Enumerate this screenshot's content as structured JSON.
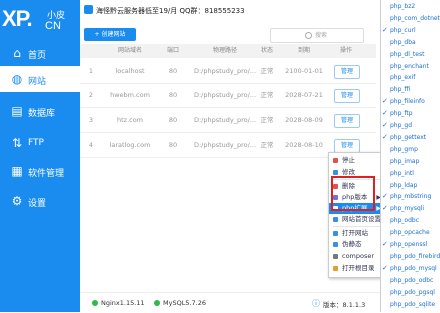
{
  "logo": {
    "big": "XP.",
    "small1": "小皮",
    "small2": "CN"
  },
  "nav": [
    {
      "label": "首页",
      "icon": "home-icon"
    },
    {
      "label": "网站",
      "icon": "globe-icon",
      "active": true
    },
    {
      "label": "数据库",
      "icon": "database-icon"
    },
    {
      "label": "FTP",
      "icon": "ftp-icon"
    },
    {
      "label": "软件管理",
      "icon": "apps-icon"
    },
    {
      "label": "设置",
      "icon": "gear-icon"
    }
  ],
  "titlebar": {
    "text": "海怪黔云服务器低至19/月 QQ群：818555233"
  },
  "toolbar": {
    "create_label": "+ 创建网站",
    "search_placeholder": "搜索"
  },
  "table": {
    "headers": [
      "网站域名",
      "端口",
      "物理路径",
      "状态",
      "到期",
      "操作"
    ],
    "rows": [
      {
        "num": "1",
        "domain": "localhost",
        "port": "80",
        "path": "D:/phpstudy_pro/...",
        "status": "正常",
        "expire": "2100-01-01",
        "action": "管理"
      },
      {
        "num": "2",
        "domain": "hwebm.com",
        "port": "80",
        "path": "D:/phpstudy_pro/...",
        "status": "正常",
        "expire": "2028-07-21",
        "action": "管理"
      },
      {
        "num": "3",
        "domain": "htz.com",
        "port": "80",
        "path": "D:/phpstudy_pro/...",
        "status": "正常",
        "expire": "2028-08-09",
        "action": "管理"
      },
      {
        "num": "4",
        "domain": "laratlog.com",
        "port": "80",
        "path": "D:/phpstudy_pro/...",
        "status": "正常",
        "expire": "2028-08-10",
        "action": "管理"
      }
    ]
  },
  "context_menu": {
    "items": [
      "停止",
      "修改",
      "删除",
      "php版本",
      "php扩展",
      "网站首页设置",
      "打开网站",
      "伪静态",
      "composer",
      "打开根目录"
    ],
    "highlighted": "php扩展"
  },
  "php_extensions": [
    {
      "name": "php_bz2",
      "checked": false
    },
    {
      "name": "php_com_dotnet",
      "checked": false
    },
    {
      "name": "php_curl",
      "checked": true
    },
    {
      "name": "php_dba",
      "checked": false
    },
    {
      "name": "php_dl_test",
      "checked": false
    },
    {
      "name": "php_enchant",
      "checked": false
    },
    {
      "name": "php_exif",
      "checked": false
    },
    {
      "name": "php_ffi",
      "checked": false
    },
    {
      "name": "php_fileinfo",
      "checked": true
    },
    {
      "name": "php_ftp",
      "checked": true
    },
    {
      "name": "php_gd",
      "checked": true
    },
    {
      "name": "php_gettext",
      "checked": true
    },
    {
      "name": "php_gmp",
      "checked": false
    },
    {
      "name": "php_imap",
      "checked": false
    },
    {
      "name": "php_intl",
      "checked": false
    },
    {
      "name": "php_ldap",
      "checked": false
    },
    {
      "name": "php_mbstring",
      "checked": true
    },
    {
      "name": "php_mysqli",
      "checked": true
    },
    {
      "name": "php_odbc",
      "checked": false
    },
    {
      "name": "php_opcache",
      "checked": false
    },
    {
      "name": "php_openssl",
      "checked": true
    },
    {
      "name": "php_pdo_firebird",
      "checked": false
    },
    {
      "name": "php_pdo_mysql",
      "checked": true
    },
    {
      "name": "php_pdo_odbc",
      "checked": false
    },
    {
      "name": "php_pdo_pgsql",
      "checked": false
    },
    {
      "name": "php_pdo_sqlite",
      "checked": false
    }
  ],
  "bottom": {
    "nginx": "Nginx1.15.11",
    "mysql": "MySQL5.7.26",
    "version": "版本：8.1.1.3"
  },
  "colors": {
    "accent": "#1a8cf0",
    "highlight_box": "#e02020",
    "running": "#2fba4a"
  }
}
